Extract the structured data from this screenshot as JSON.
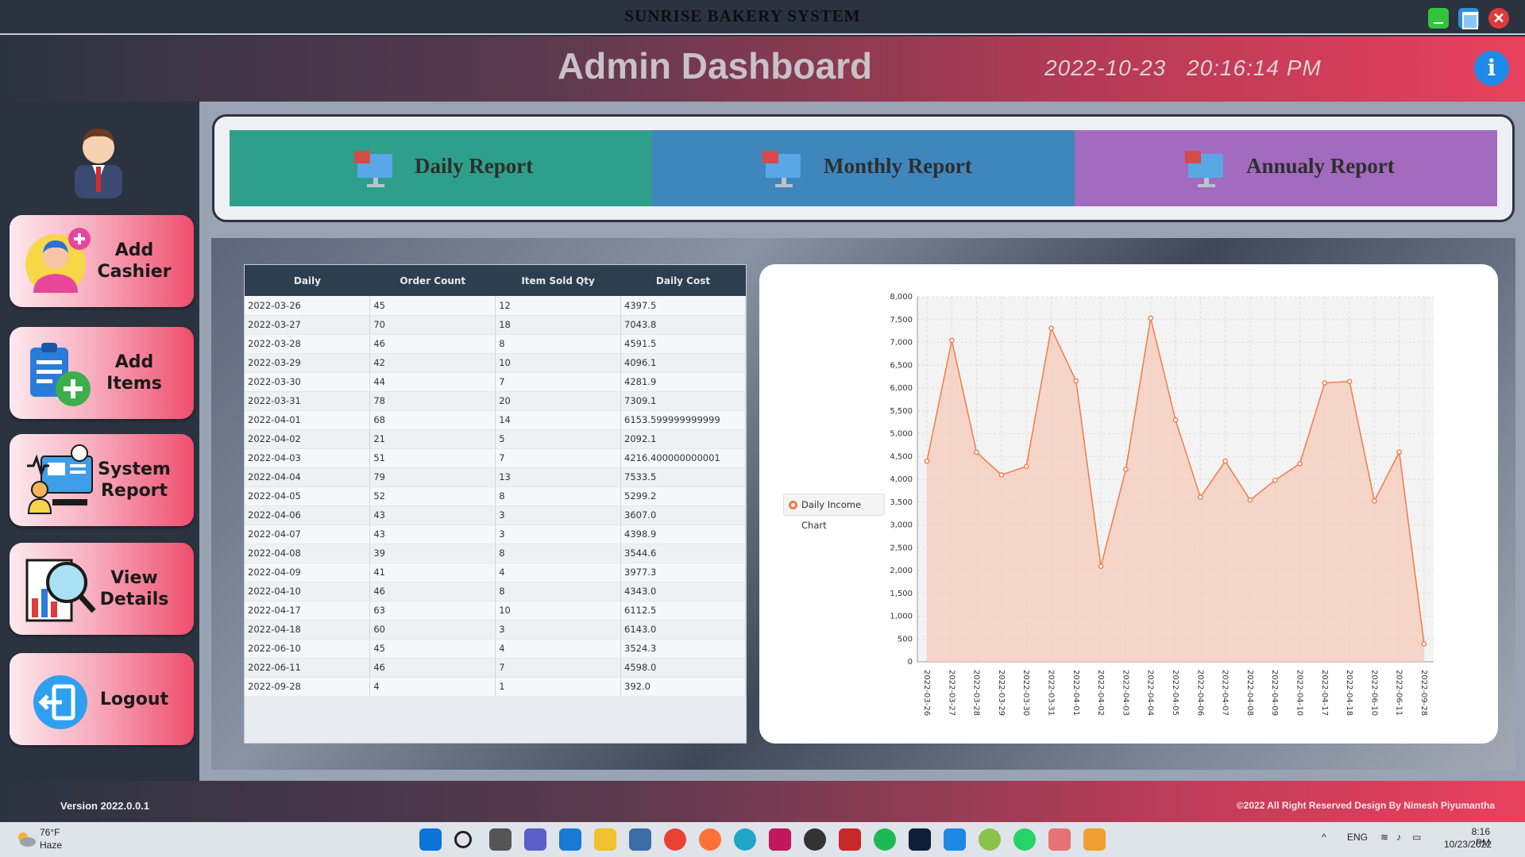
{
  "window": {
    "title": "SUNRISE BAKERY SYSTEM"
  },
  "header": {
    "title": "Admin Dashboard",
    "date": "2022-10-23",
    "time": "20:16:14 PM"
  },
  "sidebar": {
    "items": [
      {
        "label": "Add\nCashier"
      },
      {
        "label": "Add\nItems"
      },
      {
        "label": "System\nReport"
      },
      {
        "label": "View\nDetails"
      },
      {
        "label": "Logout"
      }
    ]
  },
  "reports": {
    "daily": "Daily Report",
    "monthly": "Monthly Report",
    "annual": "Annualy Report"
  },
  "table": {
    "headers": [
      "Daily",
      "Order Count",
      "Item Sold Qty",
      "Daily Cost"
    ],
    "rows": [
      [
        "2022-03-26",
        "45",
        "12",
        "4397.5"
      ],
      [
        "2022-03-27",
        "70",
        "18",
        "7043.8"
      ],
      [
        "2022-03-28",
        "46",
        "8",
        "4591.5"
      ],
      [
        "2022-03-29",
        "42",
        "10",
        "4096.1"
      ],
      [
        "2022-03-30",
        "44",
        "7",
        "4281.9"
      ],
      [
        "2022-03-31",
        "78",
        "20",
        "7309.1"
      ],
      [
        "2022-04-01",
        "68",
        "14",
        "6153.599999999999"
      ],
      [
        "2022-04-02",
        "21",
        "5",
        "2092.1"
      ],
      [
        "2022-04-03",
        "51",
        "7",
        "4216.400000000001"
      ],
      [
        "2022-04-04",
        "79",
        "13",
        "7533.5"
      ],
      [
        "2022-04-05",
        "52",
        "8",
        "5299.2"
      ],
      [
        "2022-04-06",
        "43",
        "3",
        "3607.0"
      ],
      [
        "2022-04-07",
        "43",
        "3",
        "4398.9"
      ],
      [
        "2022-04-08",
        "39",
        "8",
        "3544.6"
      ],
      [
        "2022-04-09",
        "41",
        "4",
        "3977.3"
      ],
      [
        "2022-04-10",
        "46",
        "8",
        "4343.0"
      ],
      [
        "2022-04-17",
        "63",
        "10",
        "6112.5"
      ],
      [
        "2022-04-18",
        "60",
        "3",
        "6143.0"
      ],
      [
        "2022-06-10",
        "45",
        "4",
        "3524.3"
      ],
      [
        "2022-06-11",
        "46",
        "7",
        "4598.0"
      ],
      [
        "2022-09-28",
        "4",
        "1",
        "392.0"
      ]
    ]
  },
  "chart_data": {
    "type": "area",
    "legend": "Daily Income Chart",
    "legend_position": "left",
    "grid": true,
    "ylim": [
      0,
      8000
    ],
    "yticks": [
      "0",
      "500",
      "1,000",
      "1,500",
      "2,000",
      "2,500",
      "3,000",
      "3,500",
      "4,000",
      "4,500",
      "5,000",
      "5,500",
      "6,000",
      "6,500",
      "7,000",
      "7,500",
      "8,000"
    ],
    "categories": [
      "2022-03-26",
      "2022-03-27",
      "2022-03-28",
      "2022-03-29",
      "2022-03-30",
      "2022-03-31",
      "2022-04-01",
      "2022-04-02",
      "2022-04-03",
      "2022-04-04",
      "2022-04-05",
      "2022-04-06",
      "2022-04-07",
      "2022-04-08",
      "2022-04-09",
      "2022-04-10",
      "2022-04-17",
      "2022-04-18",
      "2022-06-10",
      "2022-06-11",
      "2022-09-28"
    ],
    "series": [
      {
        "name": "Daily Income Chart",
        "values": [
          4397.5,
          7043.8,
          4591.5,
          4096.1,
          4281.9,
          7309.1,
          6153.6,
          2092.1,
          4216.4,
          7533.5,
          5299.2,
          3607.0,
          4398.9,
          3544.6,
          3977.3,
          4343.0,
          6112.5,
          6143.0,
          3524.3,
          4598.0,
          392.0
        ]
      }
    ],
    "colors": {
      "line": "#f07b4a",
      "fill": "#f5cbb8"
    }
  },
  "footer": {
    "version": "Version 2022.0.0.1",
    "copyright": "©2022  All Right Reserved Design By Nimesh Piyumantha"
  },
  "taskbar": {
    "temperature": "76°F",
    "condition": "Haze",
    "language": "ENG",
    "clock_time": "8:16 PM",
    "clock_date": "10/23/2022"
  }
}
